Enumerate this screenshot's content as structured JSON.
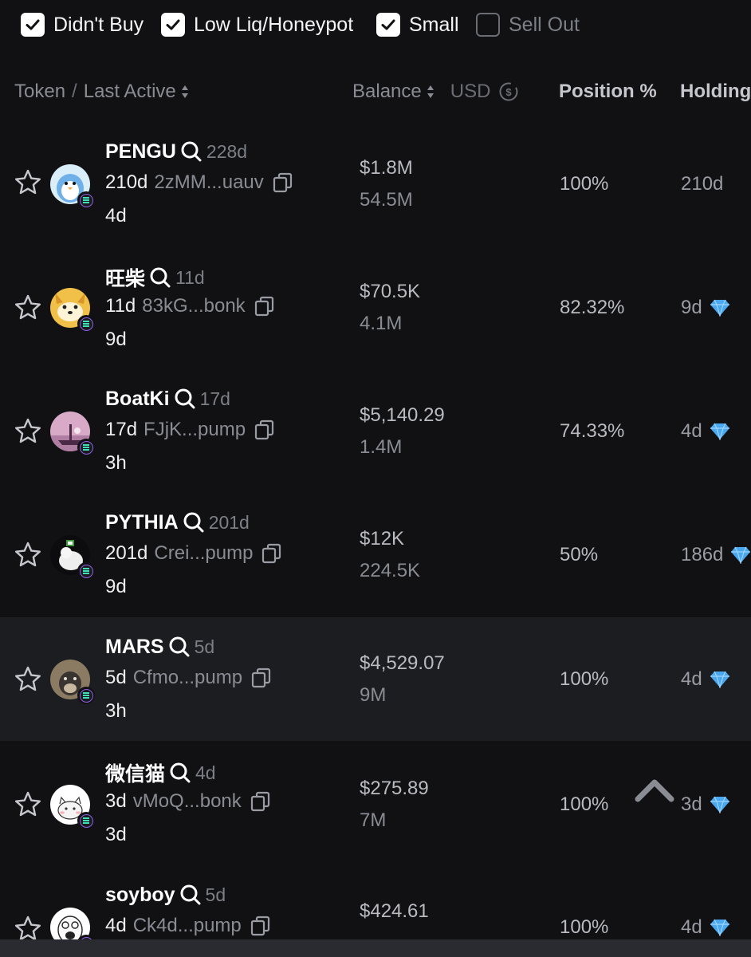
{
  "filters": [
    {
      "label": "Didn't Buy",
      "checked": true
    },
    {
      "label": "Low Liq/Honeypot",
      "checked": true
    },
    {
      "label": "Small",
      "checked": true
    },
    {
      "label": "Sell Out",
      "checked": false
    }
  ],
  "header": {
    "token": "Token",
    "slash": "/",
    "last_active": "Last Active",
    "balance": "Balance",
    "usd": "USD",
    "position": "Position %",
    "holding": "Holding"
  },
  "rows": [
    {
      "name": "PENGU",
      "age": "228d",
      "active": "210d",
      "address": "2zMM...uauv",
      "last": "4d",
      "usd": "$1.8M",
      "amount": "54.5M",
      "position": "100%",
      "holding": "210d",
      "diamond": false,
      "avatar": "pengu-avatar"
    },
    {
      "name": "旺柴",
      "age": "11d",
      "active": "11d",
      "address": "83kG...bonk",
      "last": "9d",
      "usd": "$70.5K",
      "amount": "4.1M",
      "position": "82.32%",
      "holding": "9d",
      "diamond": true,
      "avatar": "shiba-avatar"
    },
    {
      "name": "BoatKi",
      "age": "17d",
      "active": "17d",
      "address": "FJjK...pump",
      "last": "3h",
      "usd": "$5,140.29",
      "amount": "1.4M",
      "position": "74.33%",
      "holding": "4d",
      "diamond": true,
      "avatar": "boatki-avatar"
    },
    {
      "name": "PYTHIA",
      "age": "201d",
      "active": "201d",
      "address": "Crei...pump",
      "last": "9d",
      "usd": "$12K",
      "amount": "224.5K",
      "position": "50%",
      "holding": "186d",
      "diamond": true,
      "avatar": "pythia-avatar"
    },
    {
      "name": "MARS",
      "age": "5d",
      "active": "5d",
      "address": "Cfmo...pump",
      "last": "3h",
      "usd": "$4,529.07",
      "amount": "9M",
      "position": "100%",
      "holding": "4d",
      "diamond": true,
      "avatar": "mars-avatar"
    },
    {
      "name": "微信猫",
      "age": "4d",
      "active": "3d",
      "address": "vMoQ...bonk",
      "last": "3d",
      "usd": "$275.89",
      "amount": "7M",
      "position": "100%",
      "holding": "3d",
      "diamond": true,
      "avatar": "cat-avatar"
    },
    {
      "name": "soyboy",
      "age": "5d",
      "active": "4d",
      "address": "Ck4d...pump",
      "last": "",
      "usd": "$424.61",
      "amount": "",
      "position": "100%",
      "holding": "4d",
      "diamond": true,
      "avatar": "soyboy-avatar"
    }
  ],
  "colors": {
    "background": "#111114",
    "highlight_row": "#1c1d21",
    "diamond": "#4aa8f0",
    "solana_border": "#8e5fe8",
    "solana_bars": "#3fe0b8"
  }
}
